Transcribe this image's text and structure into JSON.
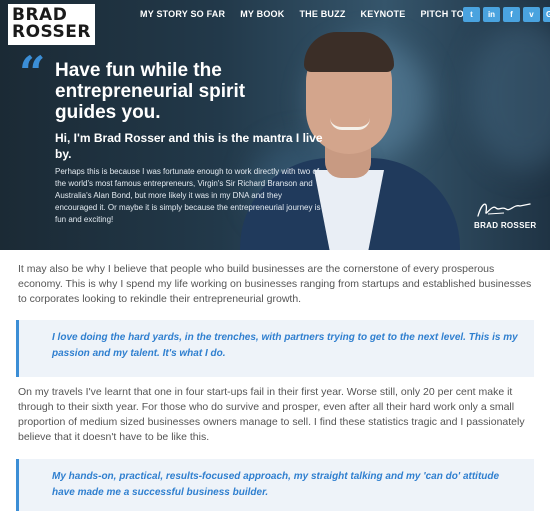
{
  "brand": {
    "line1": "BRAD",
    "line2": "ROSSER"
  },
  "nav": [
    {
      "label": "MY STORY SO FAR"
    },
    {
      "label": "MY BOOK"
    },
    {
      "label": "THE BUZZ"
    },
    {
      "label": "KEYNOTE"
    },
    {
      "label": "PITCH TO ME"
    }
  ],
  "social": [
    {
      "glyph": "t",
      "icon": "twitter-icon",
      "color": "#4aa3df"
    },
    {
      "glyph": "in",
      "icon": "linkedin-icon",
      "color": "#4aa3df"
    },
    {
      "glyph": "f",
      "icon": "facebook-icon",
      "color": "#4aa3df"
    },
    {
      "glyph": "v",
      "icon": "vimeo-icon",
      "color": "#4aa3df"
    },
    {
      "glyph": "G+",
      "icon": "google-plus-icon",
      "color": "#4aa3df"
    }
  ],
  "hero": {
    "quote_glyph": "“",
    "headline": "Have fun while the entrepreneurial spirit guides you.",
    "subhead": "Hi, I'm Brad Rosser and this is the mantra I live by.",
    "body": "Perhaps this is because I was fortunate enough to work directly with two of the world's most famous entrepreneurs, Virgin's Sir Richard Branson and Australia's Alan Bond, but more likely it was in my DNA and they encouraged it. Or maybe it is simply because the entrepreneurial journey is fun and exciting!",
    "signature_name": "BRAD ROSSER"
  },
  "content": {
    "paragraph1": "It may also be why I believe that people who build businesses are the cornerstone of every prosperous economy. This is why I spend my life working on businesses ranging from startups and established businesses to corporates looking to rekindle their entrepreneurial growth.",
    "quote1": "I love doing the hard yards, in the trenches, with partners trying to get to the next level. This is my passion and my talent. It's what I do.",
    "paragraph2": "On my travels I've learnt that one in four start-ups fail in their first year. Worse still, only 20 per cent make it through to their sixth year. For those who do survive and prosper, even after all their hard work only a small proportion of medium sized businesses owners manage to sell. I find these statistics tragic and I passionately believe that it doesn't have to be like this.",
    "quote2": "My hands-on, practical, results-focused approach, my straight talking and my 'can do' attitude have made me a successful business builder."
  },
  "colors": {
    "accent": "#3b8ed6",
    "quote_bg": "#eef3f9",
    "hero_dark": "#1b2a35"
  }
}
